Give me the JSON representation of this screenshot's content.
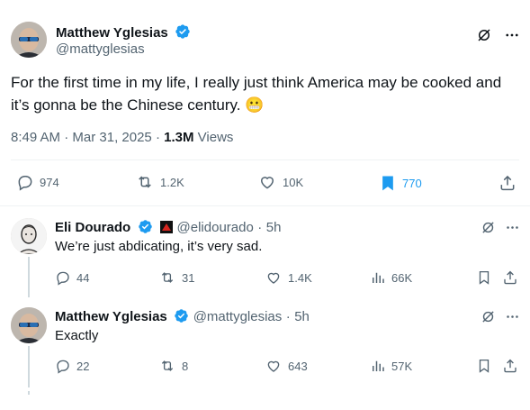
{
  "main_tweet": {
    "author_name": "Matthew Yglesias",
    "author_handle": "@mattyglesias",
    "text": "For the first time in my life, I really just think America may be cooked and it’s gonna be the Chinese century.",
    "emoji": "😬",
    "time": "8:49 AM",
    "date": "Mar 31, 2025",
    "views_count": "1.3M",
    "views_label": "Views",
    "replies": "974",
    "reposts": "1.2K",
    "likes": "10K",
    "bookmarks": "770",
    "bookmark_color": "#1d9bf0"
  },
  "replies": [
    {
      "author_name": "Eli Dourado",
      "author_handle": "@elidourado",
      "time": "5h",
      "text": "We’re just abdicating, it’s very sad.",
      "replies": "44",
      "reposts": "31",
      "likes": "1.4K",
      "views": "66K"
    },
    {
      "author_name": "Matthew Yglesias",
      "author_handle": "@mattyglesias",
      "time": "5h",
      "text": "Exactly",
      "replies": "22",
      "reposts": "8",
      "likes": "643",
      "views": "57K"
    }
  ],
  "separator_dot": "·",
  "colors": {
    "verified": "#1d9bf0",
    "muted": "#536471",
    "text": "#0f1419"
  },
  "icons": [
    "grok-icon",
    "more-icon",
    "reply-icon",
    "repost-icon",
    "like-icon",
    "bookmark-icon",
    "share-icon",
    "views-icon",
    "verified-icon",
    "affiliation-badge-icon"
  ]
}
